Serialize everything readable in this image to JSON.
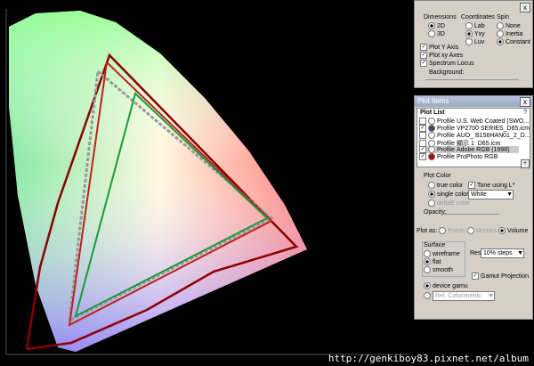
{
  "view_panel": {
    "close": "x",
    "dimensions": {
      "label": "Dimensions",
      "options": [
        "2D",
        "3D"
      ],
      "selected": "2D"
    },
    "coordinates": {
      "label": "Coordinates",
      "options": [
        "Lab",
        "Yxy",
        "Luv"
      ],
      "selected": "Yxy"
    },
    "spin": {
      "label": "Spin",
      "options": [
        "None",
        "Inertia",
        "Constant"
      ],
      "selected": "Constant"
    },
    "checks": [
      {
        "label": "Plot Y Axis",
        "checked": true
      },
      {
        "label": "Plot xy Axes",
        "checked": true
      },
      {
        "label": "Spectrum Locus",
        "checked": true
      }
    ],
    "background_label": "Background:"
  },
  "plot_items": {
    "title": "Plot Items",
    "close": "x",
    "list_label": "Plot List",
    "help": "?",
    "add": "+",
    "rows": [
      {
        "checked": false,
        "dot": "#ffffff",
        "type": "Profile",
        "name": "U.S. Web Coated (SWO..."
      },
      {
        "checked": true,
        "dot": "#5a3a7a",
        "type": "Profile",
        "name": "VP2700 SERIES_D65.icm"
      },
      {
        "checked": false,
        "dot": "#ffffff",
        "type": "Profile",
        "name": "AUO_ B156HAN01_2_D..."
      },
      {
        "checked": false,
        "dot": "#ffffff",
        "type": "Profile",
        "name": "顯示 1_D65.icm"
      },
      {
        "checked": true,
        "dot": "#ffffff",
        "type": "Profile",
        "name": "Adobe RGB (1998)",
        "selected": true
      },
      {
        "checked": true,
        "dot": "#c00000",
        "type": "Profile",
        "name": "ProPhoto RGB"
      }
    ],
    "plot_color": {
      "label": "Plot Color",
      "true_color": "true color",
      "single_color": "single color",
      "deltaE": "deltaE color",
      "selected": "single color",
      "tone_label": "Tone using L*",
      "tone_checked": true,
      "color_value": "White"
    },
    "opacity_label": "Opacity:",
    "plot_as": {
      "label": "Plot as:",
      "options": [
        "Points",
        "Vectors",
        "Volume"
      ],
      "selected": "Volume"
    },
    "surface": {
      "label": "Surface",
      "options": [
        "wireframe",
        "flat",
        "smooth"
      ],
      "selected": "flat"
    },
    "res_label": "Res:",
    "res_value": "10% steps",
    "gamut_projection": {
      "label": "Gamut Projection",
      "checked": true
    },
    "device_gamut": "device gamu",
    "intent": "Rel. Colorimetric"
  },
  "watermark": "http://genkiboy83.pixnet.net/album"
}
